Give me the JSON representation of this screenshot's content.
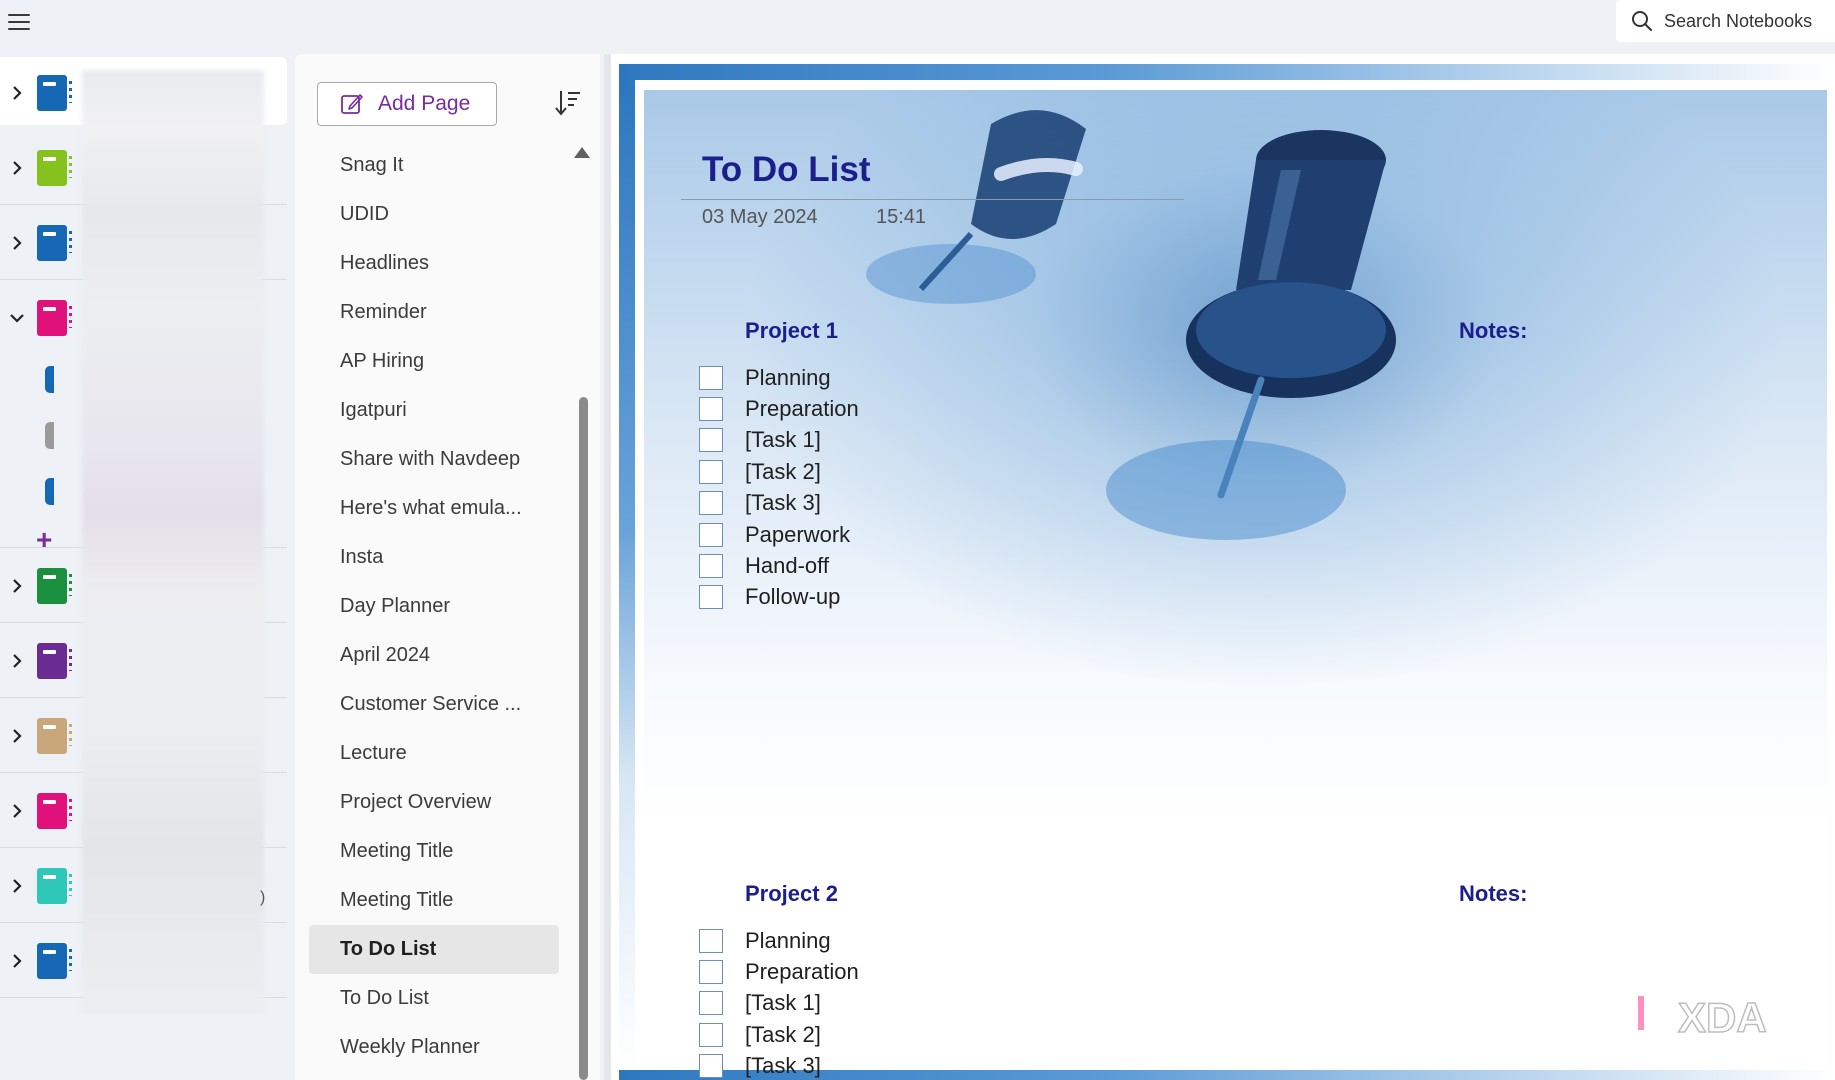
{
  "topbar": {
    "search_label": "Search Notebooks"
  },
  "notebooks": [
    {
      "color": "#1668b5",
      "expanded": false
    },
    {
      "color": "#86c21e",
      "expanded": false
    },
    {
      "color": "#1668b5",
      "expanded": false
    },
    {
      "color": "#e0117a",
      "expanded": true
    },
    {
      "color": "#1a8f3e",
      "expanded": false
    },
    {
      "color": "#6a2c93",
      "expanded": false
    },
    {
      "color": "#c9a77a",
      "expanded": false
    },
    {
      "color": "#e0117a",
      "expanded": false
    },
    {
      "color": "#2ec7b8",
      "expanded": false
    },
    {
      "color": "#1668b5",
      "expanded": false
    }
  ],
  "sections": [
    {
      "color": "#1668b5"
    },
    {
      "color": "#9a9a9a"
    },
    {
      "color": "#1668b5"
    }
  ],
  "page_panel": {
    "add_page_label": "Add Page",
    "pages": [
      "Snag It",
      "UDID",
      "Headlines",
      "Reminder",
      "AP Hiring",
      "Igatpuri",
      "Share with Navdeep",
      "Here's what emula...",
      "Insta",
      "Day Planner",
      "April 2024",
      "Customer Service ...",
      "Lecture",
      "Project Overview",
      "Meeting Title",
      "Meeting Title",
      "To Do List",
      "To Do List",
      "Weekly Planner"
    ],
    "active_index": 16
  },
  "note": {
    "title": "To Do List",
    "date": "03 May 2024",
    "time": "15:41",
    "projects": [
      {
        "heading": "Project 1",
        "notes_label": "Notes:",
        "tasks": [
          "Planning",
          "Preparation",
          "[Task 1]",
          "[Task 2]",
          "[Task 3]",
          "Paperwork",
          "Hand-off",
          "Follow-up"
        ]
      },
      {
        "heading": "Project 2",
        "notes_label": "Notes:",
        "tasks": [
          "Planning",
          "Preparation",
          "[Task 1]",
          "[Task 2]",
          "[Task 3]"
        ]
      }
    ]
  },
  "watermark": {
    "text": "XDA"
  },
  "colors": {
    "accent": "#7a2b9e",
    "title_navy": "#1b1f8c"
  }
}
